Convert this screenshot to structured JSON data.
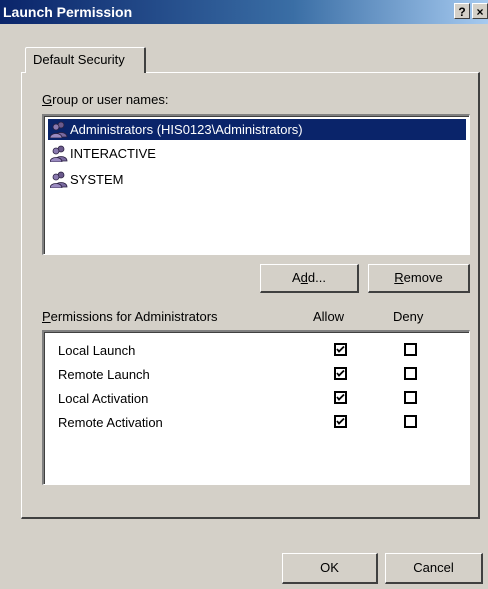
{
  "window": {
    "title": "Launch Permission",
    "help_glyph": "?",
    "close_glyph": "×"
  },
  "tabs": [
    {
      "label": "Default Security",
      "active": true
    }
  ],
  "groups": {
    "label_mnemonic": "G",
    "label_rest": "roup or user names:",
    "items": [
      {
        "name": "Administrators (HIS0123\\Administrators)",
        "icon": "user-group-icon",
        "selected": true
      },
      {
        "name": "INTERACTIVE",
        "icon": "user-group-icon",
        "selected": false
      },
      {
        "name": "SYSTEM",
        "icon": "user-group-icon",
        "selected": false
      }
    ]
  },
  "buttons": {
    "add_pre": "A",
    "add_mnemonic": "d",
    "add_post": "d...",
    "remove_mnemonic": "R",
    "remove_rest": "emove",
    "ok": "OK",
    "cancel": "Cancel"
  },
  "permissions": {
    "label_mnemonic": "P",
    "label_rest": "ermissions for Administrators",
    "allow_header": "Allow",
    "deny_header": "Deny",
    "rows": [
      {
        "name": "Local Launch",
        "allow": true,
        "deny": false
      },
      {
        "name": "Remote Launch",
        "allow": true,
        "deny": false
      },
      {
        "name": "Local Activation",
        "allow": true,
        "deny": false
      },
      {
        "name": "Remote Activation",
        "allow": true,
        "deny": false
      }
    ]
  },
  "colors": {
    "title_bar": "#0a246a",
    "selection": "#0a246a",
    "face": "#d4d0c8"
  }
}
